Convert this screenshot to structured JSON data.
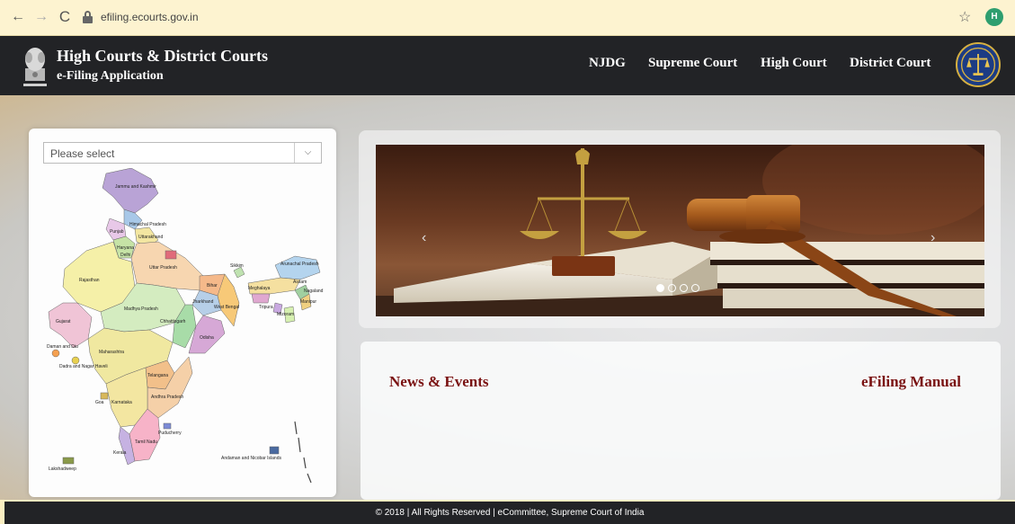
{
  "browser": {
    "back_icon": "←",
    "forward_icon": "→",
    "reload_icon": "C",
    "url": "efiling.ecourts.gov.in",
    "star_icon": "☆",
    "profile_initial": "H"
  },
  "header": {
    "title": "High Courts & District Courts",
    "subtitle": "e-Filing Application",
    "nav": [
      "NJDG",
      "Supreme Court",
      "High Court",
      "District Court"
    ]
  },
  "map_panel": {
    "select_value": "Please select",
    "states": [
      "Jammu and Kashmir",
      "Himachal Pradesh",
      "Punjab",
      "Uttarakhand",
      "Haryana",
      "Delhi",
      "Rajasthan",
      "Uttar Pradesh",
      "Sikkim",
      "Arunachal Pradesh",
      "Assam",
      "Nagaland",
      "Meghalaya",
      "Manipur",
      "Tripura",
      "Mizoram",
      "Bihar",
      "Gujarat",
      "Madhya Pradesh",
      "Jharkhand",
      "West Bengal",
      "Chhattisgarh",
      "Odisha",
      "Daman and Diu",
      "Dadra and Nagar Haveli",
      "Maharashtra",
      "Telangana",
      "Goa",
      "Karnataka",
      "Andhra Pradesh",
      "Puducherry",
      "Tamil Nadu",
      "Kerala",
      "Lakshadweep",
      "Andaman and Nicobar Islands"
    ]
  },
  "carousel": {
    "prev_icon": "‹",
    "next_icon": "›",
    "slide_count": 4,
    "active_slide": 1
  },
  "news": {
    "news_title": "News & Events",
    "manual_title": "eFiling Manual"
  },
  "footer": {
    "text": "© 2018 | All Rights Reserved | eCommittee, Supreme Court of India"
  },
  "colors": {
    "header_bg": "#222326",
    "heading_red": "#7a1212",
    "chrome_bg": "#fdf3d0"
  }
}
